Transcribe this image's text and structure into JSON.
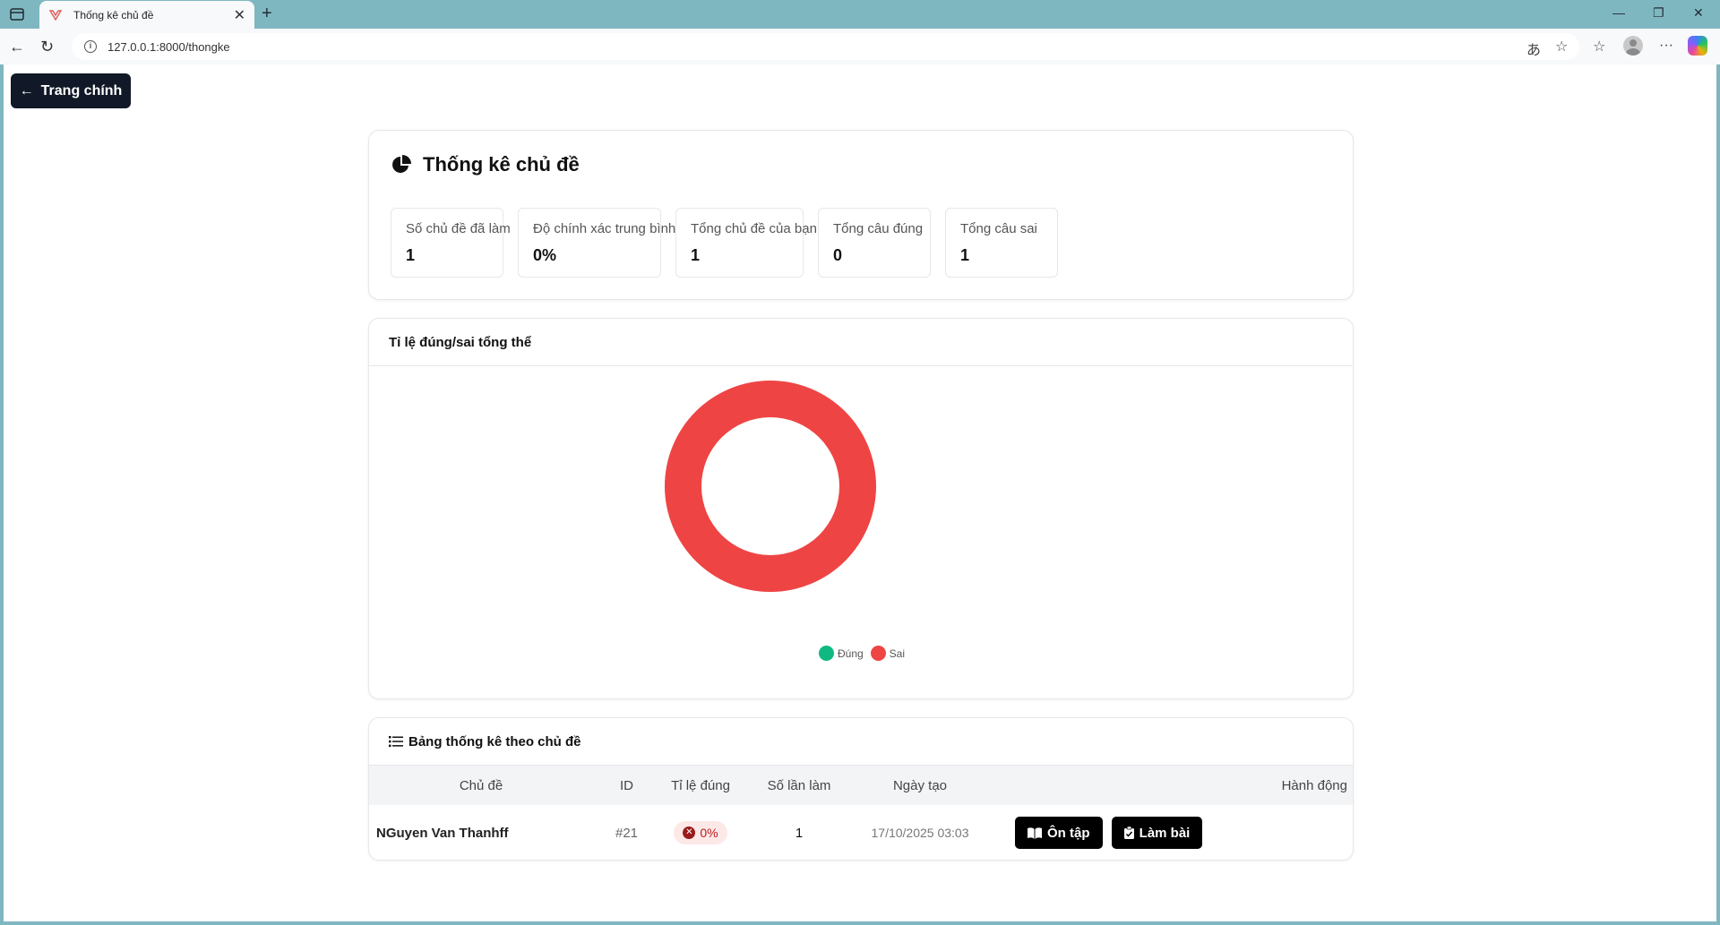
{
  "browser": {
    "tab_title": "Thống kê chủ đề",
    "url": "127.0.0.1:8000/thongke"
  },
  "back_label": "Trang chính",
  "summary": {
    "title": "Thống kê chủ đề",
    "stats": [
      {
        "label": "Số chủ đề đã làm",
        "value": "1"
      },
      {
        "label": "Độ chính xác trung bình",
        "value": "0%"
      },
      {
        "label": "Tổng chủ đề của bạn",
        "value": "1"
      },
      {
        "label": "Tổng câu đúng",
        "value": "0"
      },
      {
        "label": "Tổng câu sai",
        "value": "1"
      }
    ]
  },
  "chart_section_title": "Tỉ lệ đúng/sai tổng thể",
  "chart_data": {
    "type": "pie",
    "categories": [
      "Đúng",
      "Sai"
    ],
    "values": [
      0,
      1
    ],
    "colors": [
      "#10b981",
      "#ef4444"
    ],
    "donut": true,
    "legend": "bottom"
  },
  "table": {
    "title": "Bảng thống kê theo chủ đề",
    "headers": [
      "Chủ đề",
      "ID",
      "Tỉ lệ đúng",
      "Số lần làm",
      "Ngày tạo",
      "Hành động"
    ],
    "rows": [
      {
        "name": "NGuyen Van Thanhff",
        "id": "#21",
        "rate": "0%",
        "attempts": "1",
        "created": "17/10/2025 03:03",
        "review_label": "Ôn tập",
        "do_label": "Làm bài"
      }
    ]
  }
}
